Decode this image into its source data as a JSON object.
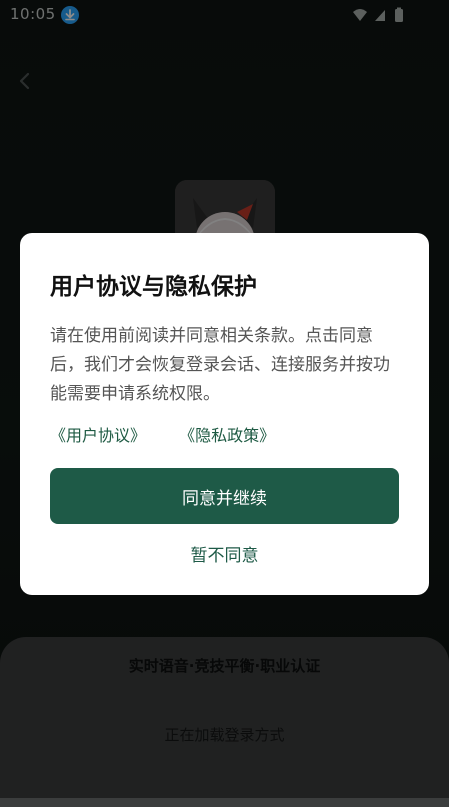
{
  "status_bar": {
    "time": "10:05",
    "icons": [
      "download-icon",
      "wifi-icon",
      "signal-icon",
      "battery-icon"
    ]
  },
  "background": {
    "slogan": "实时语音·竞技平衡·职业认证",
    "loading_text": "正在加载登录方式"
  },
  "dialog": {
    "title": "用户协议与隐私保护",
    "body": "请在使用前阅读并同意相关条款。点击同意后，我们才会恢复登录会话、连接服务并按功能需要申请系统权限。",
    "links": {
      "user_agreement": "《用户协议》",
      "privacy_policy": "《隐私政策》"
    },
    "primary_button": "同意并继续",
    "secondary_button": "暂不同意"
  },
  "colors": {
    "primary": "#1e5a47",
    "scrim": "rgba(0,0,0,0.45)"
  }
}
